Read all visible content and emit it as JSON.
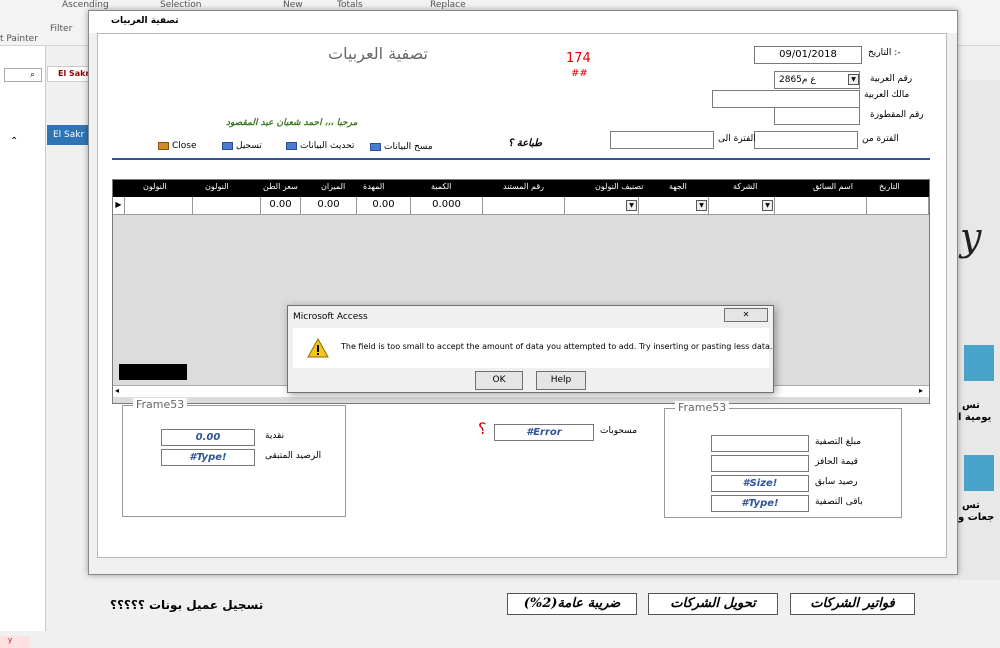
{
  "ribbon": {
    "ascending": "Ascending",
    "selection": "Selection",
    "new": "New",
    "totals": "Totals",
    "replace": "Replace",
    "filter": "Filter",
    "painter": "t Painter"
  },
  "background": {
    "tab_label": "El Sakr",
    "bar_label": "El Sakr",
    "big_text": "y",
    "side_text_1": "تس",
    "side_text_2": "يومية ا",
    "side_text_3": "تس",
    "side_text_4": "جعات و",
    "left_y": "y",
    "bottom_label": "تسجيل عميل بونات ؟؟؟؟؟",
    "buttons": [
      "فواتير الشركات",
      "تحويل الشركات",
      "ضريبة عامة(2%)"
    ]
  },
  "window": {
    "title": "تصفية العربيات",
    "header_title": "تصفية العربيات",
    "record_number": "174",
    "record_hash": "##",
    "date_label": "التاريخ :-",
    "date_value": "09/01/2018",
    "vehicle_label": "رقم العربية",
    "vehicle_value": "2865ع م",
    "owner_label": "مالك العربية",
    "trailer_label": "رقم المقطورة",
    "period_from_label": "الفترة من",
    "period_to_label": "الفترة الى",
    "print_label": "طباعة ؟",
    "welcome": "مرحبا ،،، احمد شعبان عبد المقصود",
    "toolbar": {
      "clear": "مسح البيانات",
      "refresh": "تحديث البيانات",
      "save": "تسجيل",
      "close": "Close"
    }
  },
  "grid": {
    "columns": [
      "التاريخ",
      "اسم السائق",
      "الشركة",
      "الجهة",
      "تصنيف النولون",
      "رقم المستند",
      "الكمية",
      "المهدة",
      "الميزان",
      "سعر الطن",
      "النولون",
      "النولون"
    ],
    "row": [
      "0.00",
      "0.00",
      "0.00",
      "0.000"
    ]
  },
  "frame_left": {
    "title": "Frame53",
    "cash_label": "نقدية",
    "cash_value": "0.00",
    "remaining_label": "الرصيد المتبقى",
    "remaining_value": "#Type!"
  },
  "middle": {
    "withdrawals_label": "مسحوبات",
    "withdrawals_value": "#Error",
    "question": "؟"
  },
  "frame_right": {
    "title": "Frame53",
    "amount_label": "مبلغ التصفية",
    "incentive_label": "قيمة الحافز",
    "prev_balance_label": "رصيد سابق",
    "prev_balance_value": "#Size!",
    "rest_label": "باقى التصفية",
    "rest_value": "#Type!"
  },
  "dialog": {
    "title": "Microsoft Access",
    "message": "The field is too small to accept the amount of data you attempted to add. Try inserting or pasting less data.",
    "ok": "OK",
    "help": "Help",
    "close": "✕"
  }
}
